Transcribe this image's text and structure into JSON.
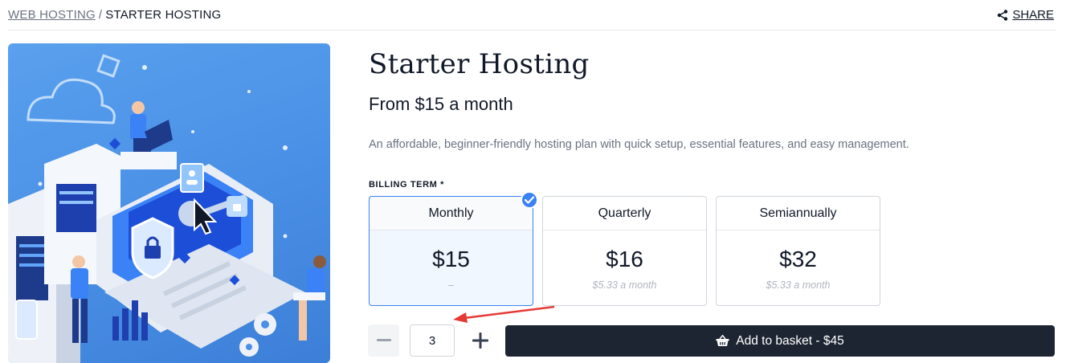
{
  "breadcrumb": {
    "parent": "WEB HOSTING",
    "separator": "/",
    "current": "STARTER HOSTING"
  },
  "share_label": "SHARE",
  "product": {
    "title": "Starter Hosting",
    "price_from": "From $15 a month",
    "description": "An affordable, beginner-friendly hosting plan with quick setup, essential features, and easy management."
  },
  "billing": {
    "label": "BILLING TERM *",
    "selected": "Monthly",
    "terms": [
      {
        "name": "Monthly",
        "price": "$15",
        "sub": "–"
      },
      {
        "name": "Quarterly",
        "price": "$16",
        "sub": "$5.33 a month"
      },
      {
        "name": "Semiannually",
        "price": "$32",
        "sub": "$5.33 a month"
      }
    ]
  },
  "quantity": {
    "value": "3"
  },
  "basket_label": "Add to basket - $45",
  "icons": {
    "share": "share-icon",
    "check": "check-circle-icon",
    "minus": "minus-icon",
    "plus": "plus-icon",
    "basket": "basket-icon"
  },
  "colors": {
    "accent": "#3b82f6",
    "selected_bg": "#f0f7fe",
    "basket_bg": "#1e2532",
    "annotation": "#e53935"
  }
}
